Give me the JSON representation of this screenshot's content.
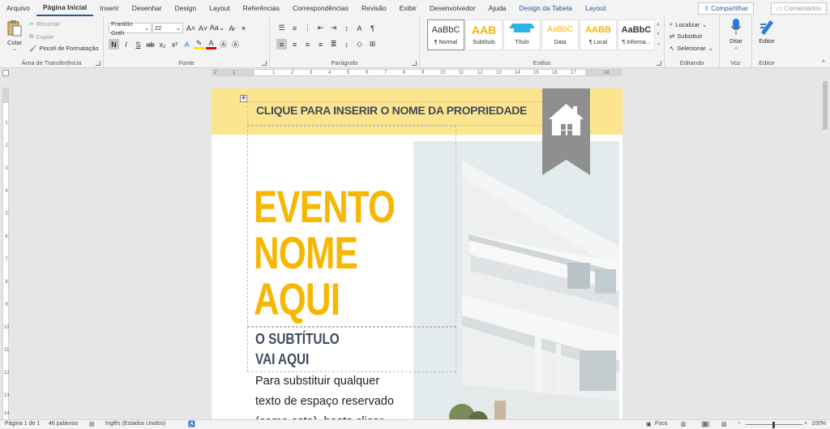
{
  "tabs": [
    "Arquivo",
    "Página Inicial",
    "Inserir",
    "Desenhar",
    "Design",
    "Layout",
    "Referências",
    "Correspondências",
    "Revisão",
    "Exibir",
    "Desenvolvedor",
    "Ajuda",
    "Design da Tabela",
    "Layout"
  ],
  "share_label": "Compartilhar",
  "comments_label": "Comentários",
  "clipboard": {
    "paste": "Colar",
    "cut": "Recortar",
    "copy": "Copiar",
    "format_painter": "Pincel de Formatação",
    "label": "Área de Transferência"
  },
  "font": {
    "name": "Franklin Goth",
    "size": "22",
    "bold": "N",
    "italic": "I",
    "underline": "S",
    "label": "Fonte"
  },
  "paragraph": {
    "label": "Parágrafo"
  },
  "styles": {
    "label": "Estilos",
    "items": [
      {
        "preview": "AaBbC",
        "name": "¶ Normal"
      },
      {
        "preview": "AAB",
        "name": "Subtítulo"
      },
      {
        "preview": "",
        "name": "Título"
      },
      {
        "preview": "AaBbC",
        "name": "Data"
      },
      {
        "preview": "AABB",
        "name": "¶ Local"
      },
      {
        "preview": "AaBbC",
        "name": "¶ Informa..."
      }
    ]
  },
  "editing": {
    "find": "Localizar",
    "replace": "Substituir",
    "select": "Selecionar",
    "label": "Editando"
  },
  "voice": {
    "dictate": "Ditar",
    "label": "Voz"
  },
  "editor": {
    "button": "Editor",
    "label": "Editor"
  },
  "ruler_h": [
    "2",
    "1",
    "1",
    "2",
    "3",
    "4",
    "5",
    "6",
    "7",
    "8",
    "9",
    "10",
    "11",
    "12",
    "13",
    "14",
    "15",
    "16",
    "17",
    "18"
  ],
  "ruler_v": [
    "1",
    "2",
    "3",
    "4",
    "5",
    "6",
    "7",
    "8",
    "9",
    "10",
    "11",
    "12",
    "13",
    "14"
  ],
  "document": {
    "property": "CLIQUE PARA INSERIR O NOME DA PROPRIEDADE",
    "title1": "EVENTO",
    "title2": "NOME",
    "title3": "AQUI",
    "subtitle1": "O SUBTÍTULO",
    "subtitle2": "VAI AQUI",
    "body1": "Para substituir qualquer",
    "body2": "texto de espaço reservado",
    "body3": "(como este), basta clicar"
  },
  "status": {
    "page": "Página 1 de 1",
    "words": "46 palavras",
    "language": "Inglês (Estados Unidos)",
    "focus": "Foco",
    "zoom": "100%"
  },
  "colors": {
    "accent": "#2b579a",
    "yellow_band": "#fde58f",
    "title": "#f7b700",
    "subtitle": "#3f4a5c",
    "flag": "#8f8f8f"
  }
}
